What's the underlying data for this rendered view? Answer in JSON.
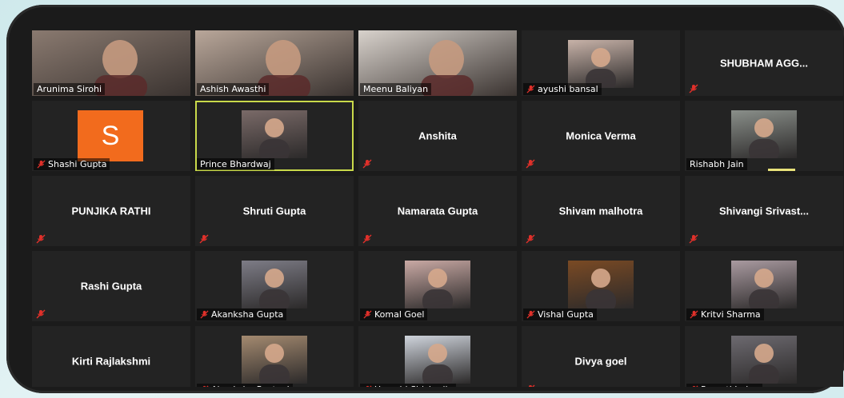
{
  "participants": [
    {
      "name": "Arunima Sirohi",
      "kind": "video",
      "muted": false,
      "bg": "#8a7a70"
    },
    {
      "name": "Ashish Awasthi",
      "kind": "video",
      "muted": false,
      "bg": "#b9a79a"
    },
    {
      "name": "Meenu Baliyan",
      "kind": "video",
      "muted": false,
      "bg": "#d8d2cc"
    },
    {
      "name": "ayushi bansal",
      "kind": "photo",
      "muted": true,
      "bg": "#c7b2a8"
    },
    {
      "name": "SHUBHAM AGG...",
      "kind": "name",
      "muted": true
    },
    {
      "name": "Shashi Gupta",
      "kind": "letter",
      "letter": "S",
      "muted": true
    },
    {
      "name": "Prince Bhardwaj",
      "kind": "photo",
      "muted": false,
      "active": true,
      "bg": "#7a6a68"
    },
    {
      "name": "Anshita",
      "kind": "name",
      "muted": true
    },
    {
      "name": "Monica Verma",
      "kind": "name",
      "muted": true
    },
    {
      "name": "Rishabh Jain",
      "kind": "photo",
      "muted": false,
      "speaking": true,
      "bg": "#8a8f8a"
    },
    {
      "name": "PUNJIKA RATHI",
      "kind": "name",
      "muted": true
    },
    {
      "name": "Shruti Gupta",
      "kind": "name",
      "muted": true
    },
    {
      "name": "Namarata Gupta",
      "kind": "name",
      "muted": true
    },
    {
      "name": "Shivam malhotra",
      "kind": "name",
      "muted": true
    },
    {
      "name": "Shivangi  Srivast...",
      "kind": "name",
      "muted": true
    },
    {
      "name": "Rashi Gupta",
      "kind": "name",
      "muted": true
    },
    {
      "name": "Akanksha Gupta",
      "kind": "photo",
      "muted": true,
      "bg": "#7d7c86"
    },
    {
      "name": "Komal Goel",
      "kind": "photo",
      "muted": true,
      "bg": "#c9a9a4"
    },
    {
      "name": "Vishal Gupta",
      "kind": "photo",
      "muted": true,
      "bg": "#7a4a24"
    },
    {
      "name": "Kritvi Sharma",
      "kind": "photo",
      "muted": true,
      "bg": "#a99aa0"
    },
    {
      "name": "Kirti Rajlakshmi",
      "kind": "name",
      "muted": false
    },
    {
      "name": "Akanksha Rastogi",
      "kind": "photo",
      "muted": true,
      "bg": "#a48a70"
    },
    {
      "name": "Urvashi Shishodia",
      "kind": "photo",
      "muted": true,
      "bg": "#cfd4dc"
    },
    {
      "name": "Divya goel",
      "kind": "name",
      "muted": true
    },
    {
      "name": "Pragati Jadon",
      "kind": "photo",
      "muted": true,
      "bg": "#6d6a70"
    }
  ],
  "colors": {
    "tile_bg": "#232323",
    "active_border": "#c9d94a",
    "mute_red": "#e0302a",
    "letter_avatar": "#f26b1d"
  }
}
